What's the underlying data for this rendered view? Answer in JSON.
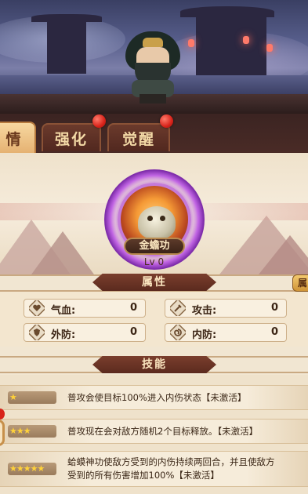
{
  "tabs": [
    {
      "label": "详情",
      "visible_label": "情",
      "active": true
    },
    {
      "label": "强化",
      "active": false
    },
    {
      "label": "觉醒",
      "active": false
    }
  ],
  "skill_card": {
    "name": "金蟾功",
    "level": "Lv 0"
  },
  "attributes_section": {
    "title": "属性",
    "side_tab_label": "属"
  },
  "attributes": [
    {
      "name": "气血:",
      "value": "0",
      "icon": "heart-icon"
    },
    {
      "name": "攻击:",
      "value": "0",
      "icon": "sword-icon"
    },
    {
      "name": "外防:",
      "value": "0",
      "icon": "shield-icon"
    },
    {
      "name": "内防:",
      "value": "0",
      "icon": "swirl-icon"
    }
  ],
  "skills_section": {
    "title": "技能"
  },
  "skills": [
    {
      "stars": "★",
      "star_count": 1,
      "text": "普攻会使目标100%进入内伤状态【未激活】"
    },
    {
      "stars": "★★★",
      "star_count": 3,
      "text": "普攻现在会对敌方随机2个目标释放。【未激活】"
    },
    {
      "stars": "★★★★★",
      "star_count": 5,
      "text_line1": "蛤蟆神功使敌方受到的内伤持续两回合，并且使敌方",
      "text_line2": "受到的所有伤害增加100%【未激活】"
    }
  ],
  "colors": {
    "accent": "#d8231a",
    "panel": "#f1e6d2",
    "header": "#5b2a1e",
    "orb": "#b04fe0"
  }
}
